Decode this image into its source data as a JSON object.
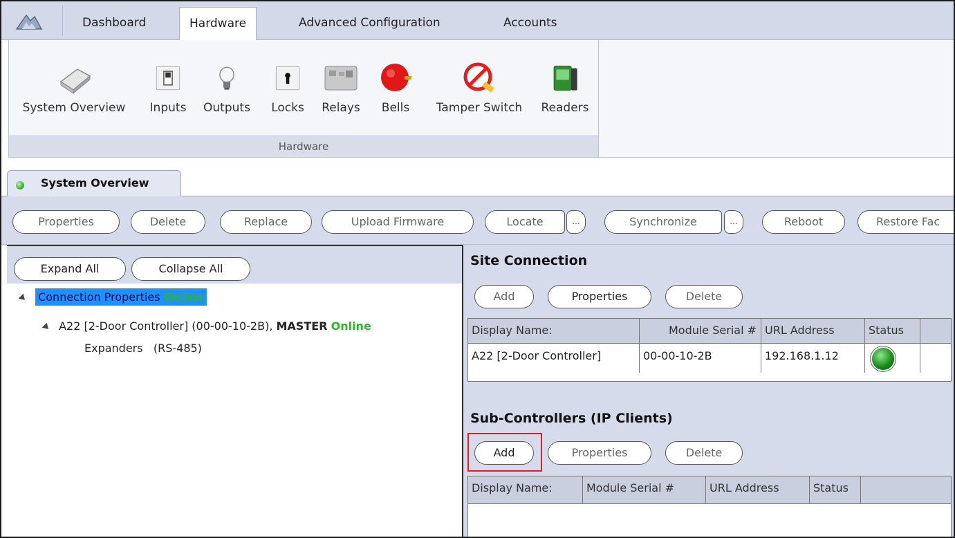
{
  "top_tabs": [
    "Dashboard",
    "Hardware",
    "Advanced Configuration",
    "Accounts"
  ],
  "active_top_tab": "Hardware",
  "ribbon": {
    "items": [
      {
        "label": "System Overview",
        "icon": "system-overview-icon"
      },
      {
        "label": "Inputs",
        "icon": "toggle-switch-icon"
      },
      {
        "label": "Outputs",
        "icon": "light-bulb-icon"
      },
      {
        "label": "Locks",
        "icon": "lock-icon"
      },
      {
        "label": "Relays",
        "icon": "relay-board-icon"
      },
      {
        "label": "Bells",
        "icon": "bell-icon"
      },
      {
        "label": "Tamper Switch",
        "icon": "tamper-switch-icon"
      },
      {
        "label": "Readers",
        "icon": "card-reader-icon"
      }
    ],
    "group_label": "Hardware"
  },
  "document_tab": {
    "title": "System Overview",
    "status_color": "#3fb23a"
  },
  "actions": {
    "properties": "Properties",
    "delete": "Delete",
    "replace": "Replace",
    "upload_firmware": "Upload Firmware",
    "locate": "Locate",
    "locate_more": "...",
    "synchronize": "Synchronize",
    "synchronize_more": "...",
    "reboot": "Reboot",
    "restore": "Restore Fac"
  },
  "tree": {
    "expand_all": "Expand All",
    "collapse_all": "Collapse All",
    "root": {
      "label": "Connection Properties",
      "status": "Online"
    },
    "controller": {
      "label": "A22 [2-Door Controller] (00-00-10-2B),",
      "role": "MASTER",
      "status": "Online"
    },
    "expanders": "Expanders   (RS-485)"
  },
  "site_connection": {
    "title": "Site Connection",
    "buttons": {
      "add": "Add",
      "properties": "Properties",
      "delete": "Delete"
    },
    "columns": [
      "Display Name:",
      "Module Serial #",
      "URL Address",
      "Status"
    ],
    "rows": [
      {
        "display_name": "A22 [2-Door Controller]",
        "module_serial": "00-00-10-2B",
        "url_address": "192.168.1.12",
        "status": "online"
      }
    ]
  },
  "sub_controllers": {
    "title": "Sub-Controllers (IP Clients)",
    "buttons": {
      "add": "Add",
      "properties": "Properties",
      "delete": "Delete"
    },
    "columns": [
      "Display Name:",
      "Module Serial #",
      "URL Address",
      "Status"
    ],
    "rows": []
  },
  "colors": {
    "selection": "#1e90ff",
    "online": "#2db52d",
    "highlight": "#e02020",
    "toolbar": "#d6dbeb"
  }
}
